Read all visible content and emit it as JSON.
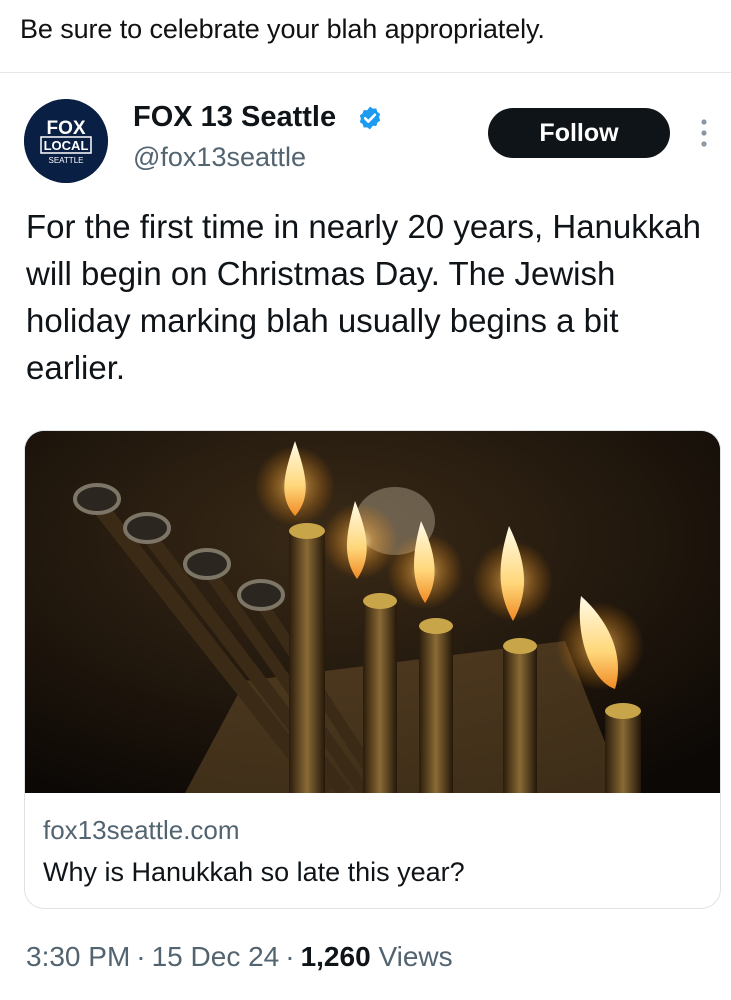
{
  "caption": "Be sure to celebrate your blah appropriately.",
  "tweet": {
    "avatar": {
      "line1": "FOX",
      "line2": "LOCAL",
      "line3": "SEATTLE"
    },
    "display_name": "FOX 13 Seattle",
    "verified_icon": "verified-badge-icon",
    "handle": "@fox13seattle",
    "follow_label": "Follow",
    "more_icon": "more-options-icon",
    "text": "For the first time in nearly 20 years, Hanukkah will begin on Christmas Day. The Jewish holiday marking blah usually begins a bit earlier.",
    "link_card": {
      "image_icon": "menorah-photo",
      "domain": "fox13seattle.com",
      "title": "Why is Hanukkah so late this year?"
    },
    "time": "3:30 PM",
    "date": "15 Dec 24",
    "views_count": "1,260",
    "views_label": "Views"
  },
  "colors": {
    "text": "#0f1419",
    "secondary": "#536471",
    "verified": "#1d9bf0",
    "follow_bg": "#0f1419",
    "avatar_bg": "#0a1f44"
  }
}
